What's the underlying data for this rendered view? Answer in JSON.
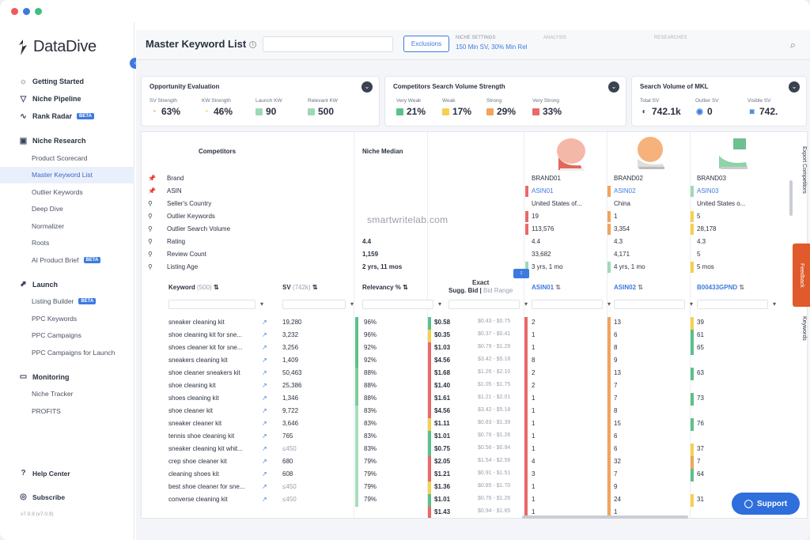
{
  "colors": {
    "accent": "#3d7ae0",
    "red": "#e86a6a",
    "orange": "#f2a35c",
    "yellow": "#f5d050",
    "green": "#5cc08a",
    "feedback": "#e05a2b"
  },
  "sidebar": {
    "logo": "DataDive",
    "items": [
      {
        "label": "Getting Started",
        "icon": "bulb-icon",
        "type": "top"
      },
      {
        "label": "Niche Pipeline",
        "icon": "funnel-icon",
        "type": "top"
      },
      {
        "label": "Rank Radar",
        "icon": "pulse-icon",
        "type": "top",
        "badge": "BETA"
      },
      {
        "label": "Niche Research",
        "icon": "research-icon",
        "type": "section"
      },
      {
        "label": "Product Scorecard",
        "type": "sub"
      },
      {
        "label": "Master Keyword List",
        "type": "sub",
        "active": true
      },
      {
        "label": "Outlier Keywords",
        "type": "sub"
      },
      {
        "label": "Deep Dive",
        "type": "sub"
      },
      {
        "label": "Normalizer",
        "type": "sub"
      },
      {
        "label": "Roots",
        "type": "sub"
      },
      {
        "label": "AI Product Brief",
        "type": "sub",
        "badge": "BETA"
      },
      {
        "label": "Launch",
        "icon": "rocket-icon",
        "type": "section"
      },
      {
        "label": "Listing Builder",
        "type": "sub",
        "badge": "BETA"
      },
      {
        "label": "PPC Keywords",
        "type": "sub"
      },
      {
        "label": "PPC Campaigns",
        "type": "sub"
      },
      {
        "label": "PPC Campaigns for Launch",
        "type": "sub"
      },
      {
        "label": "Monitoring",
        "icon": "monitor-icon",
        "type": "section"
      },
      {
        "label": "Niche Tracker",
        "type": "sub"
      },
      {
        "label": "PROFITS",
        "type": "sub"
      }
    ],
    "help": "Help Center",
    "subscribe": "Subscribe",
    "version": "v7.0.9 (v7.0.9)"
  },
  "topbar": {
    "title": "Master Keyword List",
    "exclusions": "Exclusions",
    "niche_settings_label": "NICHE SETTINGS",
    "niche_settings_value": "150 Min SV, 30% Min Rel",
    "blur1": "ANALYSIS",
    "blur2": "RESEARCHES"
  },
  "cards": {
    "opportunity": {
      "title": "Opportunity Evaluation",
      "metrics": [
        {
          "label": "SV Strength",
          "value": "63%"
        },
        {
          "label": "KW Strength",
          "value": "46%"
        },
        {
          "label": "Launch KW",
          "value": "90"
        },
        {
          "label": "Relevant KW",
          "value": "500"
        }
      ]
    },
    "competitors": {
      "title": "Competitors Search Volume Strength",
      "metrics": [
        {
          "label": "Very Weak",
          "value": "21%"
        },
        {
          "label": "Weak",
          "value": "17%"
        },
        {
          "label": "Strong",
          "value": "29%"
        },
        {
          "label": "Very Strong",
          "value": "33%"
        }
      ]
    },
    "volume": {
      "title": "Search Volume of MKL",
      "metrics": [
        {
          "label": "Total SV",
          "value": "742.1k"
        },
        {
          "label": "Outlier SV",
          "value": "0"
        },
        {
          "label": "Visible SV",
          "value": "742."
        }
      ]
    }
  },
  "competitors_table": {
    "competitors_label": "Competitors",
    "niche_median_label": "Niche Median",
    "rows": [
      "Brand",
      "ASIN",
      "Seller's Country",
      "Outlier Keywords",
      "Outlier Search Volume",
      "Rating",
      "Review Count",
      "Listing Age"
    ],
    "median": [
      "",
      "",
      "",
      "",
      "",
      "4.4",
      "1,159",
      "2 yrs, 11 mos"
    ],
    "brands": [
      {
        "cells": [
          "BRAND01",
          "ASIN01",
          "United States of...",
          "19",
          "113,576",
          "4.4",
          "33,682",
          "3 yrs, 1 mo"
        ]
      },
      {
        "cells": [
          "BRAND02",
          "ASIN02",
          "China",
          "1",
          "3,354",
          "4.3",
          "4,171",
          "4 yrs, 1 mo"
        ]
      },
      {
        "cells": [
          "BRAND03",
          "ASIN03",
          "United States o...",
          "5",
          "28,178",
          "4.3",
          "5",
          "5 mos"
        ]
      }
    ],
    "export_tab": "Export Competitors",
    "keywords_tab": "Keywords"
  },
  "keyword_table": {
    "headers": {
      "keyword": "Keyword",
      "keyword_count": "(500)",
      "sv": "SV",
      "sv_total": "(742k)",
      "relevancy": "Relevancy %",
      "bid_top": "Exact",
      "bid": "Sugg. Bid",
      "bid_range": "Bid Range",
      "asin1": "ASIN01",
      "asin2": "ASIN02",
      "asin3": "B00433GPND"
    },
    "rows": [
      {
        "kw": "sneaker cleaning kit",
        "sv": "19,280",
        "rel": "96%",
        "bid": "$0.58",
        "range": "$0.43 - $0.75",
        "a1": "2",
        "a2": "13",
        "a3": "39"
      },
      {
        "kw": "shoe cleaning kit for sne...",
        "sv": "3,232",
        "rel": "96%",
        "bid": "$0.35",
        "range": "$0.37 - $0.41",
        "a1": "1",
        "a2": "6",
        "a3": "61"
      },
      {
        "kw": "shoes cleaner kit for sne...",
        "sv": "3,256",
        "rel": "92%",
        "bid": "$1.03",
        "range": "$0.79 - $1.29",
        "a1": "1",
        "a2": "8",
        "a3": "65"
      },
      {
        "kw": "sneakers cleaning kit",
        "sv": "1,409",
        "rel": "92%",
        "bid": "$4.56",
        "range": "$3.42 - $5.18",
        "a1": "8",
        "a2": "9",
        "a3": ""
      },
      {
        "kw": "shoe cleaner sneakers kit",
        "sv": "50,463",
        "rel": "88%",
        "bid": "$1.68",
        "range": "$1.26 - $2.10",
        "a1": "2",
        "a2": "13",
        "a3": "63"
      },
      {
        "kw": "shoe cleaning kit",
        "sv": "25,386",
        "rel": "88%",
        "bid": "$1.40",
        "range": "$1.05 - $1.75",
        "a1": "2",
        "a2": "7",
        "a3": ""
      },
      {
        "kw": "shoes cleaning kit",
        "sv": "1,346",
        "rel": "88%",
        "bid": "$1.61",
        "range": "$1.21 - $2.01",
        "a1": "1",
        "a2": "7",
        "a3": "73"
      },
      {
        "kw": "shoe cleaner kit",
        "sv": "9,722",
        "rel": "83%",
        "bid": "$4.56",
        "range": "$3.42 - $5.18",
        "a1": "1",
        "a2": "8",
        "a3": ""
      },
      {
        "kw": "sneaker cleaner kit",
        "sv": "3,646",
        "rel": "83%",
        "bid": "$1.11",
        "range": "$0.83 - $1.39",
        "a1": "1",
        "a2": "15",
        "a3": "76"
      },
      {
        "kw": "tennis shoe cleaning kit",
        "sv": "765",
        "rel": "83%",
        "bid": "$1.01",
        "range": "$0.76 - $1.26",
        "a1": "1",
        "a2": "6",
        "a3": ""
      },
      {
        "kw": "sneaker cleaning kit whit...",
        "sv": "≤450",
        "rel": "83%",
        "bid": "$0.75",
        "range": "$0.56 - $0.94",
        "a1": "1",
        "a2": "6",
        "a3": "37"
      },
      {
        "kw": "crep shoe cleaner kit",
        "sv": "680",
        "rel": "79%",
        "bid": "$2.05",
        "range": "$1.54 - $2.56",
        "a1": "4",
        "a2": "32",
        "a3": "7"
      },
      {
        "kw": "cleaning shoes kit",
        "sv": "608",
        "rel": "79%",
        "bid": "$1.21",
        "range": "$0.91 - $1.51",
        "a1": "3",
        "a2": "7",
        "a3": "64"
      },
      {
        "kw": "best shoe cleaner for sne...",
        "sv": "≤450",
        "rel": "79%",
        "bid": "$1.36",
        "range": "$0.85 - $1.70",
        "a1": "1",
        "a2": "9",
        "a3": ""
      },
      {
        "kw": "converse cleaning kit",
        "sv": "≤450",
        "rel": "79%",
        "bid": "$1.01",
        "range": "$0.76 - $1.26",
        "a1": "1",
        "a2": "24",
        "a3": "31"
      },
      {
        "kw": "",
        "sv": "",
        "rel": "",
        "bid": "$1.43",
        "range": "$0.94 - $1.65",
        "a1": "1",
        "a2": "1",
        "a3": ""
      }
    ]
  },
  "watermark": "smartwritelab.com",
  "feedback": "Feedback",
  "support": "Support"
}
